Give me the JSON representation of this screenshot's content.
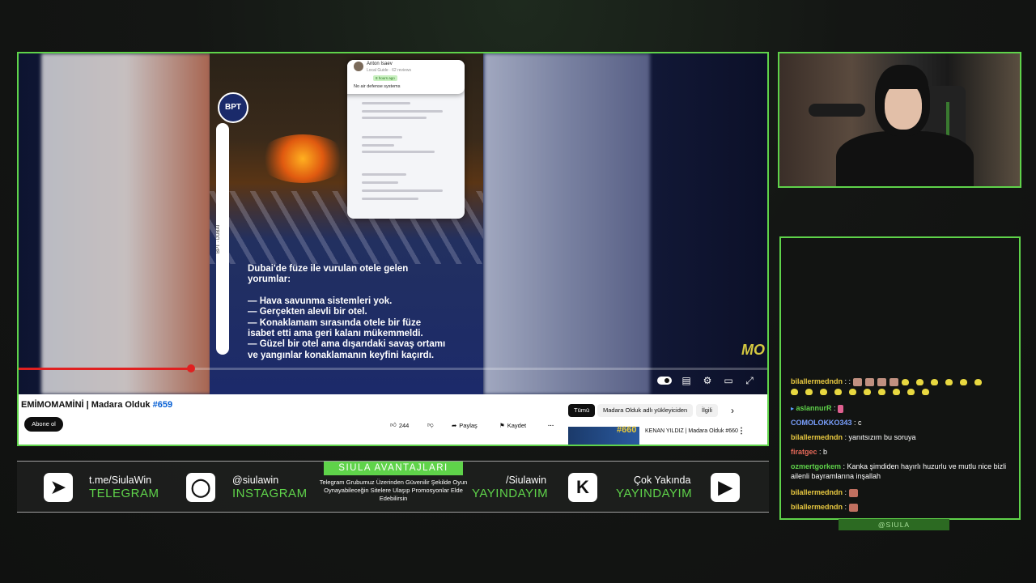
{
  "video": {
    "review_card": {
      "reviewer_name": "Anton Isaev",
      "reviewer_sub": "Local Guide · 62 reviews",
      "badge": "8 hours ago",
      "text": "No air defense systems"
    },
    "channel_logo": "BPT",
    "side_label": "BPT  ·  DUBAI",
    "caption_lines": [
      "Dubai'de füze ile vurulan otele gelen",
      "yorumlar:",
      "",
      "— Hava savunma sistemleri yok.",
      "— Gerçekten alevli bir otel.",
      "— Konaklamam sırasında otele bir füze",
      "isabet etti ama geri kalanı mükemmeldi.",
      "— Güzel bir otel ama dışarıdaki savaş ortamı",
      "ve yangınlar konaklamanın keyfini kaçırdı."
    ],
    "watermark": "MO",
    "progress": 0.23
  },
  "yt": {
    "title_main": "EMİMOMAMİNİ | Madara Olduk ",
    "title_hash": "#659",
    "subscribe_label": "Abone ol",
    "like_count": "244",
    "share_label": "Paylaş",
    "save_label": "Kaydet",
    "chips": [
      "Tümü",
      "Madara Olduk adlı yükleyiciden",
      "İlgili"
    ],
    "side_video": {
      "thumb_number": "#660",
      "title": "KENAN YILDIZ | Madara Olduk #660"
    }
  },
  "chat": {
    "messages": [
      {
        "user": "bilallermedndn",
        "text": " : :",
        "color": "#e8c840",
        "emotes": "mixed"
      },
      {
        "user": "aslannurR",
        "text": " : ",
        "color": "#5fd34a",
        "emotes": "single"
      },
      {
        "user": "COMOLOKKO343",
        "text": " : c",
        "color": "#7aa0ff"
      },
      {
        "user": "bilallermedndn",
        "text": " : yanıtsızım bu soruya",
        "color": "#e8c840"
      },
      {
        "user": "firatgec",
        "text": " : b",
        "color": "#e86a5a"
      },
      {
        "user": "ozmertgorkem",
        "text": " : Kanka şimdiden hayırlı huzurlu ve mutlu nice bizli ailenli bayramlarına inşallah",
        "color": "#5fd34a"
      },
      {
        "user": "bilallermedndn",
        "text": " : ",
        "color": "#e8c840",
        "emotes": "single"
      },
      {
        "user": "bilallermedndn",
        "text": " : ",
        "color": "#e8c840",
        "emotes": "single"
      }
    ],
    "footer": "@SIULA"
  },
  "social": {
    "telegram_handle": "t.me/SiulaWin",
    "telegram_label": "TELEGRAM",
    "instagram_handle": "@siulawin",
    "instagram_label": "INSTAGRAM",
    "avantaj_title": "SIULA AVANTAJLARI",
    "avantaj_text": "Telegram Grubumuz Üzerinden Güvenilir Şekilde Oyun Oynayabileceğin Sitelere Ulaşıp Promosyonlar Elde Edebilirsin",
    "kick_handle": "/Siulawin",
    "kick_label": "YAYINDAYIM",
    "youtube_handle": "Çok Yakında",
    "youtube_label": "YAYINDAYIM"
  },
  "colors": {
    "accent": "#5fd34a",
    "progress": "#e02020"
  },
  "icons": [
    "telegram-icon",
    "instagram-icon",
    "kick-icon",
    "youtube-icon",
    "like-icon",
    "dislike-icon",
    "share-icon",
    "save-icon",
    "more-icon",
    "settings-icon",
    "subtitles-icon",
    "fullscreen-icon",
    "theater-icon",
    "chevron-right-icon"
  ]
}
